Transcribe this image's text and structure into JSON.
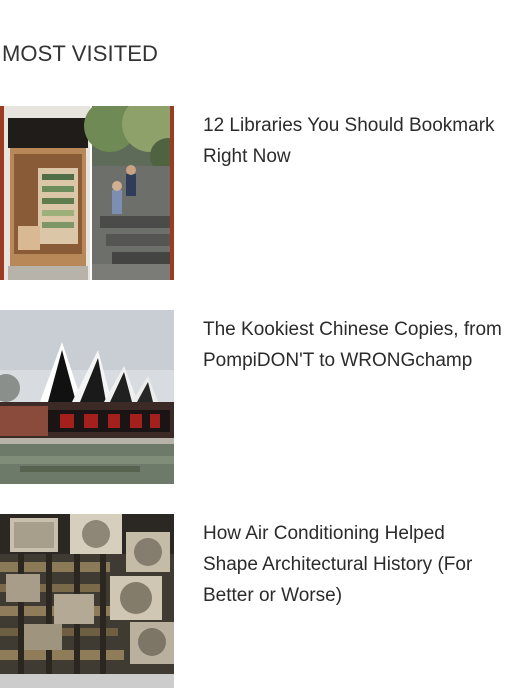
{
  "section": {
    "title": "MOST VISITED"
  },
  "items": [
    {
      "headline": "12 Libraries You Should Bookmark Right Now",
      "image_icon": "library-photo"
    },
    {
      "headline": "The Kookiest Chinese Copies, from PompiDON'T to WRONGchamp",
      "image_icon": "opera-house-copy-photo"
    },
    {
      "headline": "How Air Conditioning Helped Shape Architectural History (For Better or Worse)",
      "image_icon": "air-conditioners-photo"
    }
  ]
}
